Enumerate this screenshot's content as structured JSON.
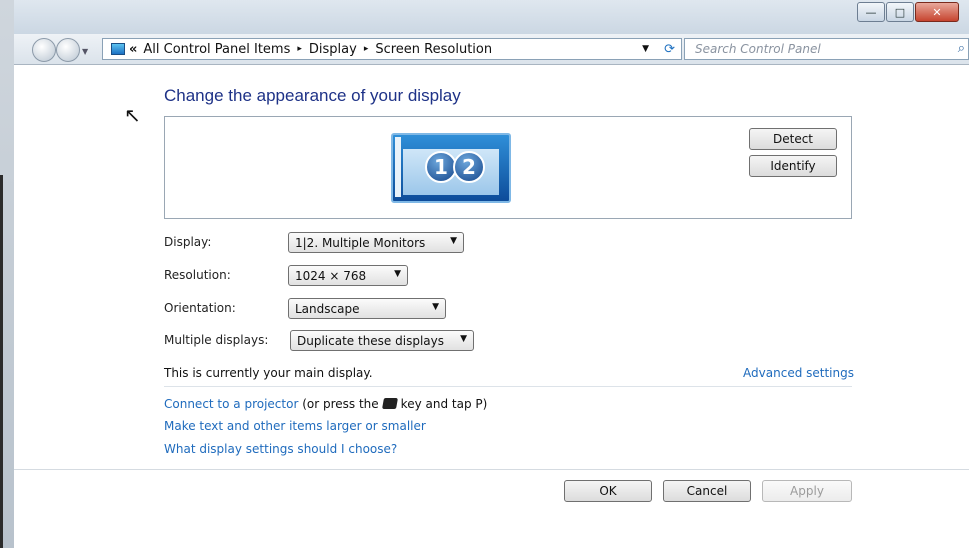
{
  "window": {
    "controls": {
      "minimize": "—",
      "maximize": "□",
      "close": "✕"
    }
  },
  "navbar": {
    "chevron": "«",
    "breadcrumb": [
      "All Control Panel Items",
      "Display",
      "Screen Resolution"
    ],
    "separator": "▸",
    "search_placeholder": "Search Control Panel"
  },
  "icons": {
    "back": "back-arrow-icon",
    "forward": "forward-arrow-icon",
    "control_panel": "control-panel-icon",
    "refresh": "refresh-icon",
    "search": "magnifier-icon",
    "windows_key": "windows-logo-icon"
  },
  "main": {
    "heading": "Change the appearance of your display",
    "monitor_badges": [
      "1",
      "2"
    ],
    "detect_label": "Detect",
    "identify_label": "Identify",
    "fields": {
      "display": {
        "label": "Display:",
        "value": "1|2. Multiple Monitors"
      },
      "resolution": {
        "label": "Resolution:",
        "value": "1024 × 768"
      },
      "orientation": {
        "label": "Orientation:",
        "value": "Landscape"
      },
      "multiple": {
        "label": "Multiple displays:",
        "value": "Duplicate these displays"
      }
    },
    "status": "This is currently your main display.",
    "advanced_link": "Advanced settings",
    "projector_link": "Connect to a projector",
    "projector_text_before": " (or press the",
    "projector_text_after": "key and tap P)",
    "text_size_link": "Make text and other items larger or smaller",
    "help_link": "What display settings should I choose?"
  },
  "footer": {
    "ok": "OK",
    "cancel": "Cancel",
    "apply": "Apply"
  },
  "colors": {
    "link": "#1f6bbd",
    "heading": "#1e3287"
  }
}
